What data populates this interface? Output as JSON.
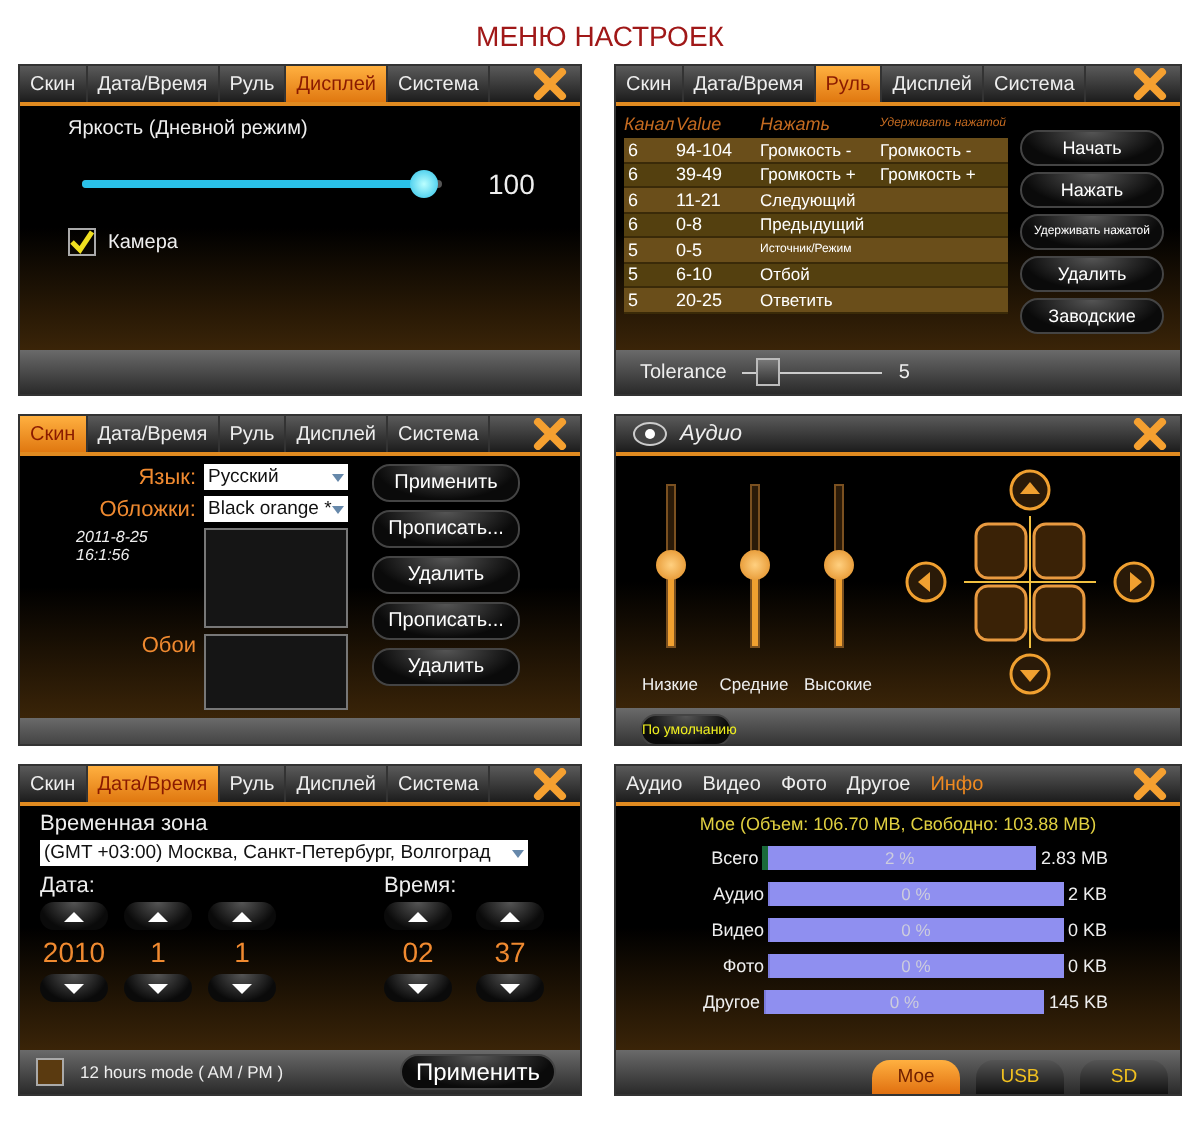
{
  "title": "МЕНЮ НАСТРОЕК",
  "display_screen": {
    "tabs": [
      {
        "label": "Скин",
        "selected": false
      },
      {
        "label": "Дата/Время",
        "selected": false
      },
      {
        "label": "Руль",
        "selected": false
      },
      {
        "label": "Дисплей",
        "selected": true
      },
      {
        "label": "Система",
        "selected": false
      }
    ],
    "brightness": {
      "label": "Яркость (Дневной режим)",
      "level": 0.95,
      "reading": "100"
    },
    "camera": {
      "label": "Камера",
      "checked": true
    }
  },
  "steering_screen": {
    "tabs": [
      {
        "label": "Скин",
        "selected": false
      },
      {
        "label": "Дата/Время",
        "selected": false
      },
      {
        "label": "Руль",
        "selected": true
      },
      {
        "label": "Дисплей",
        "selected": false
      },
      {
        "label": "Система",
        "selected": false
      }
    ],
    "columns": [
      "Канал",
      "Value",
      "Нажать",
      "Удерживать нажатой"
    ],
    "rows": [
      {
        "channel": "6",
        "value": "94-104",
        "press": "Громкость -",
        "hold": "Громкость -"
      },
      {
        "channel": "6",
        "value": "39-49",
        "press": "Громкость +",
        "hold": "Громкость +"
      },
      {
        "channel": "6",
        "value": "11-21",
        "press": "Следующий"
      },
      {
        "channel": "6",
        "value": "0-8",
        "press": "Предыдущий"
      },
      {
        "channel": "5",
        "value": "0-5",
        "press": "Источник/Режим"
      },
      {
        "channel": "5",
        "value": "6-10",
        "press": "Отбой"
      },
      {
        "channel": "5",
        "value": "20-25",
        "press": "Ответить"
      }
    ],
    "buttons": [
      "Начать",
      "Нажать",
      "Удерживать нажатой",
      "Удалить",
      "Заводские"
    ],
    "tolerance": {
      "label": "Tolerance",
      "level": 0.18,
      "reading": "5"
    }
  },
  "skin_screen": {
    "tabs": [
      {
        "label": "Скин",
        "selected": true
      },
      {
        "label": "Дата/Время",
        "selected": false
      },
      {
        "label": "Руль",
        "selected": false
      },
      {
        "label": "Дисплей",
        "selected": false
      },
      {
        "label": "Система",
        "selected": false
      }
    ],
    "language": {
      "label": "Язык:",
      "value": "Русский"
    },
    "skins": {
      "label": "Обложки:",
      "value": "Black orange *"
    },
    "date": "2011-8-25",
    "time": "16:1:56",
    "wallpaper_label": "Обои",
    "buttons": [
      "Применить",
      "Прописать...",
      "Удалить",
      "Прописать...",
      "Удалить"
    ]
  },
  "audio_screen": {
    "title": "Аудио",
    "sliders": [
      {
        "label": "Низкие",
        "level": 0.5
      },
      {
        "label": "Средние",
        "level": 0.5
      },
      {
        "label": "Высокие",
        "level": 0.5
      }
    ],
    "default_button": "По умолчанию"
  },
  "datetime_screen": {
    "tabs": [
      {
        "label": "Скин",
        "selected": false
      },
      {
        "label": "Дата/Время",
        "selected": true
      },
      {
        "label": "Руль",
        "selected": false
      },
      {
        "label": "Дисплей",
        "selected": false
      },
      {
        "label": "Система",
        "selected": false
      }
    ],
    "timezone_label": "Временная зона",
    "timezone": "(GMT +03:00) Москва, Санкт-Петербург, Волгоград",
    "date_label": "Дата:",
    "date_values": [
      "2010",
      "1",
      "1"
    ],
    "time_label": "Время:",
    "time_values": [
      "02",
      "37"
    ],
    "twelve_hour": {
      "label": "12 hours mode ( AM / PM )",
      "checked": false
    },
    "apply_button": "Применить"
  },
  "info_screen": {
    "tabs": [
      {
        "label": "Аудио",
        "selected": false
      },
      {
        "label": "Видео",
        "selected": false
      },
      {
        "label": "Фото",
        "selected": false
      },
      {
        "label": "Другое",
        "selected": false
      },
      {
        "label": "Инфо",
        "selected": true
      }
    ],
    "heading": "Мое (Объем: 106.70 MB, Свободно: 103.88 MB)",
    "rows": [
      {
        "label": "Всего",
        "level": 0.02,
        "percent": "2 %",
        "size": "2.83 MB"
      },
      {
        "label": "Аудио",
        "level": 0,
        "percent": "0 %",
        "size": "2 KB"
      },
      {
        "label": "Видео",
        "level": 0,
        "percent": "0 %",
        "size": "0 KB"
      },
      {
        "label": "Фото",
        "level": 0,
        "percent": "0 %",
        "size": "0 KB"
      },
      {
        "label": "Другое",
        "level": 0,
        "percent": "0 %",
        "size": "145 KB"
      }
    ],
    "storage_tabs": [
      {
        "label": "Мое",
        "selected": true
      },
      {
        "label": "USB",
        "selected": false
      },
      {
        "label": "SD",
        "selected": false
      }
    ]
  }
}
